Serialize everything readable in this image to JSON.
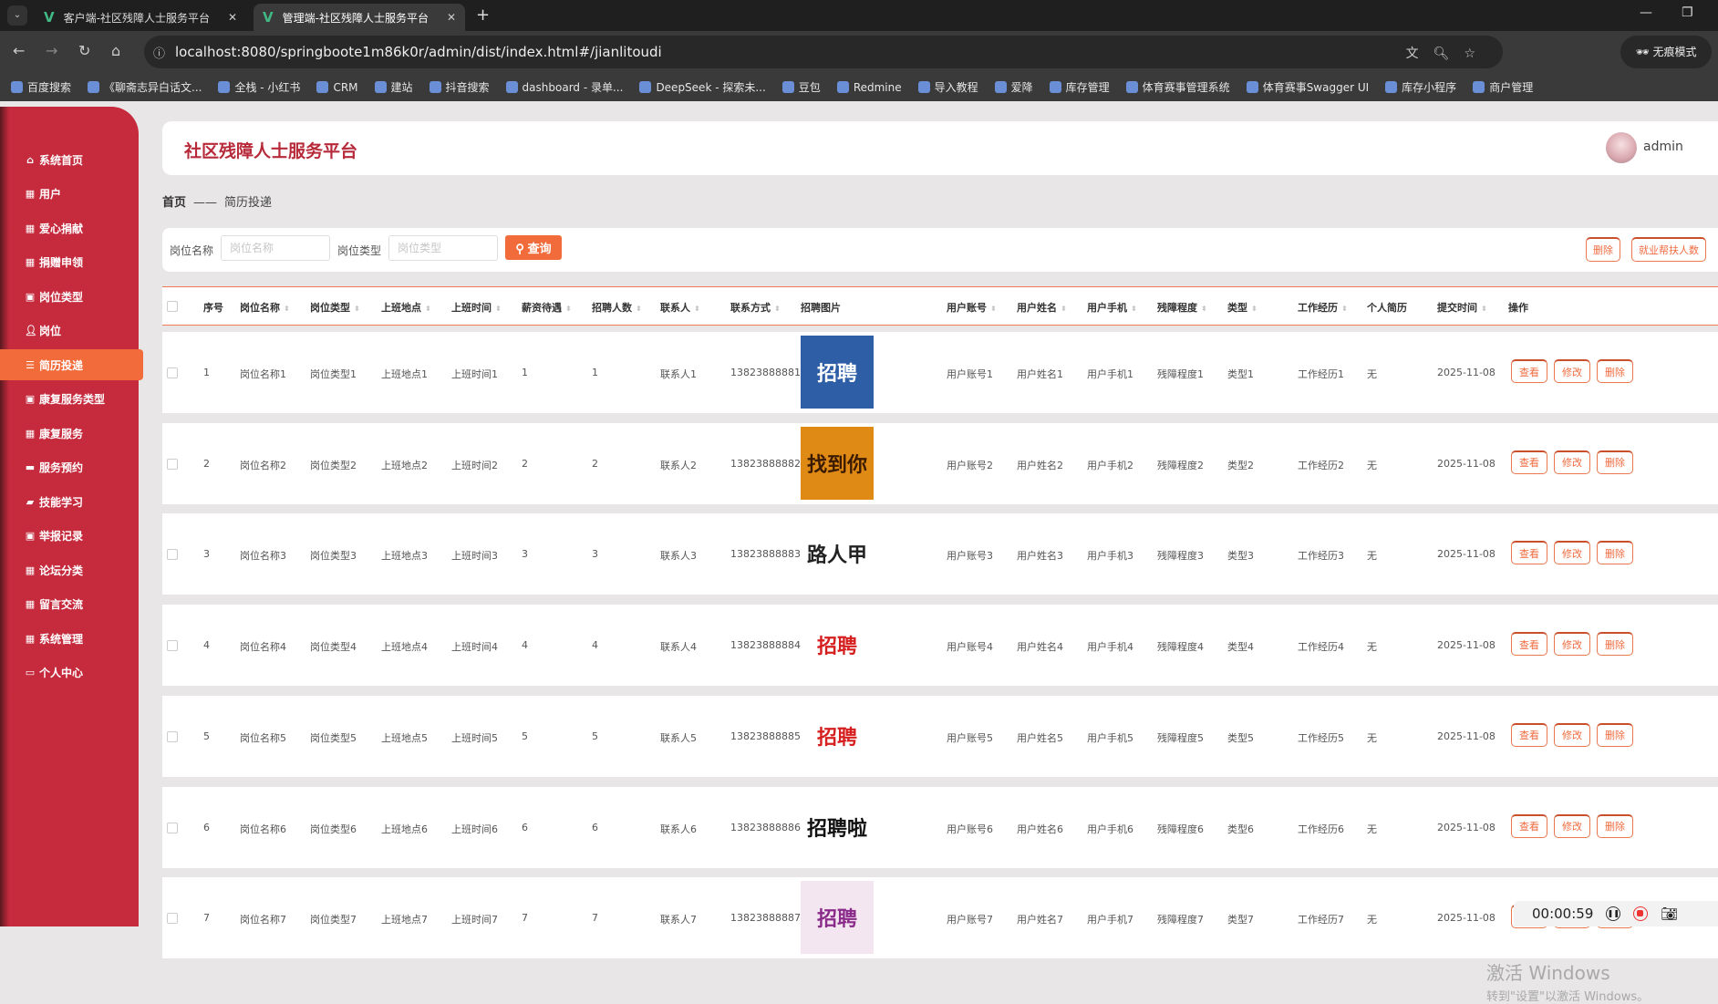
{
  "browser": {
    "tabs": [
      {
        "title": "客户端-社区残障人士服务平台",
        "active": false
      },
      {
        "title": "管理端-社区残障人士服务平台",
        "active": true
      }
    ],
    "url": "localhost:8080/springboote1m86k0r/admin/dist/index.html#/jianlitoudi",
    "incognito_label": "无痕模式",
    "bookmarks": [
      "百度搜索",
      "《聊斋志异白话文...",
      "全栈 - 小红书",
      "CRM",
      "建站",
      "抖音搜索",
      "dashboard - 录单...",
      "DeepSeek - 探索未...",
      "豆包",
      "Redmine",
      "导入教程",
      "爱降",
      "库存管理",
      "体育赛事管理系统",
      "体育赛事Swagger UI",
      "库存小程序",
      "商户管理"
    ]
  },
  "sidebar": {
    "items": [
      {
        "label": "系统首页",
        "icon": "home-icon"
      },
      {
        "label": "用户",
        "icon": "grid-icon"
      },
      {
        "label": "爱心捐献",
        "icon": "grid-icon"
      },
      {
        "label": "捐赠申领",
        "icon": "grid-icon"
      },
      {
        "label": "岗位类型",
        "icon": "clipboard-icon"
      },
      {
        "label": "岗位",
        "icon": "user-icon"
      },
      {
        "label": "简历投递",
        "icon": "list-icon",
        "active": true
      },
      {
        "label": "康复服务类型",
        "icon": "clipboard-icon"
      },
      {
        "label": "康复服务",
        "icon": "grid-icon"
      },
      {
        "label": "服务预约",
        "icon": "monitor-icon"
      },
      {
        "label": "技能学习",
        "icon": "book-icon"
      },
      {
        "label": "举报记录",
        "icon": "clipboard-icon"
      },
      {
        "label": "论坛分类",
        "icon": "grid-icon"
      },
      {
        "label": "留言交流",
        "icon": "grid-icon"
      },
      {
        "label": "系统管理",
        "icon": "grid-icon"
      },
      {
        "label": "个人中心",
        "icon": "wallet-icon"
      }
    ]
  },
  "header": {
    "title": "社区残障人士服务平台",
    "username": "admin"
  },
  "breadcrumb": {
    "home": "首页",
    "separator": "——",
    "current": "简历投递"
  },
  "search": {
    "job_name_label": "岗位名称",
    "job_name_placeholder": "岗位名称",
    "job_name_value": "",
    "job_type_label": "岗位类型",
    "job_type_placeholder": "岗位类型",
    "job_type_value": "",
    "query_label": "查询",
    "delete_label": "删除",
    "stats_label": "就业帮扶人数"
  },
  "table": {
    "columns": [
      "序号",
      "岗位名称",
      "岗位类型",
      "上班地点",
      "上班时间",
      "薪资待遇",
      "招聘人数",
      "联系人",
      "联系方式",
      "招聘图片",
      "用户账号",
      "用户姓名",
      "用户手机",
      "残障程度",
      "类型",
      "工作经历",
      "个人简历",
      "提交时间",
      "操作"
    ],
    "sortable": [
      false,
      true,
      true,
      true,
      true,
      true,
      true,
      true,
      true,
      false,
      true,
      true,
      true,
      true,
      true,
      true,
      false,
      true,
      false
    ],
    "action_labels": {
      "view": "查看",
      "edit": "修改",
      "delete": "删除"
    },
    "rows": [
      [
        "1",
        "岗位名称1",
        "岗位类型1",
        "上班地点1",
        "上班时间1",
        "1",
        "1",
        "联系人1",
        "13823888881",
        "",
        "用户账号1",
        "用户姓名1",
        "用户手机1",
        "残障程度1",
        "类型1",
        "工作经历1",
        "无",
        "2025-11-08"
      ],
      [
        "2",
        "岗位名称2",
        "岗位类型2",
        "上班地点2",
        "上班时间2",
        "2",
        "2",
        "联系人2",
        "13823888882",
        "",
        "用户账号2",
        "用户姓名2",
        "用户手机2",
        "残障程度2",
        "类型2",
        "工作经历2",
        "无",
        "2025-11-08"
      ],
      [
        "3",
        "岗位名称3",
        "岗位类型3",
        "上班地点3",
        "上班时间3",
        "3",
        "3",
        "联系人3",
        "13823888883",
        "",
        "用户账号3",
        "用户姓名3",
        "用户手机3",
        "残障程度3",
        "类型3",
        "工作经历3",
        "无",
        "2025-11-08"
      ],
      [
        "4",
        "岗位名称4",
        "岗位类型4",
        "上班地点4",
        "上班时间4",
        "4",
        "4",
        "联系人4",
        "13823888884",
        "",
        "用户账号4",
        "用户姓名4",
        "用户手机4",
        "残障程度4",
        "类型4",
        "工作经历4",
        "无",
        "2025-11-08"
      ],
      [
        "5",
        "岗位名称5",
        "岗位类型5",
        "上班地点5",
        "上班时间5",
        "5",
        "5",
        "联系人5",
        "13823888885",
        "",
        "用户账号5",
        "用户姓名5",
        "用户手机5",
        "残障程度5",
        "类型5",
        "工作经历5",
        "无",
        "2025-11-08"
      ],
      [
        "6",
        "岗位名称6",
        "岗位类型6",
        "上班地点6",
        "上班时间6",
        "6",
        "6",
        "联系人6",
        "13823888886",
        "",
        "用户账号6",
        "用户姓名6",
        "用户手机6",
        "残障程度6",
        "类型6",
        "工作经历6",
        "无",
        "2025-11-08"
      ],
      [
        "7",
        "岗位名称7",
        "岗位类型7",
        "上班地点7",
        "上班时间7",
        "7",
        "7",
        "联系人7",
        "13823888887",
        "",
        "用户账号7",
        "用户姓名7",
        "用户手机7",
        "残障程度7",
        "类型7",
        "工作经历7",
        "无",
        "2025-11-08"
      ]
    ],
    "images": [
      {
        "text": "招聘",
        "bg": "#2e5fa6",
        "fg": "#fff"
      },
      {
        "text": "找到你",
        "bg": "#e08a16",
        "fg": "#3b1c00"
      },
      {
        "text": "路人甲",
        "bg": "#ffffff",
        "fg": "#222"
      },
      {
        "text": "招聘",
        "bg": "#ffffff",
        "fg": "#d61f1f"
      },
      {
        "text": "招聘",
        "bg": "#ffffff",
        "fg": "#d61f1f"
      },
      {
        "text": "招聘啦",
        "bg": "#ffffff",
        "fg": "#111"
      },
      {
        "text": "招聘",
        "bg": "#f3e6f0",
        "fg": "#8a2a8a"
      }
    ]
  },
  "overlay": {
    "watermark_title": "激活 Windows",
    "watermark_sub": "转到\"设置\"以激活 Windows。",
    "recorder_time": "00:00:59"
  },
  "colors": {
    "primary": "#c52a3d",
    "accent": "#f26b3a",
    "title": "#b72a3a"
  }
}
